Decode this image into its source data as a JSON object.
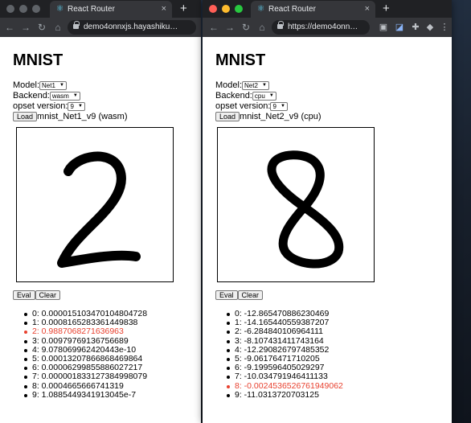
{
  "accent_highlight": "#e8412f",
  "windows": [
    {
      "tab": {
        "title": "React Router",
        "icon": "react-icon",
        "close": "×"
      },
      "new_tab": "+",
      "address": "demo4onnxjs.hayashiku…",
      "app": {
        "title": "MNIST",
        "model_label": "Model:",
        "model_value": "Net1",
        "backend_label": "Backend:",
        "backend_value": "wasm",
        "opset_label": "opset version:",
        "opset_value": "9",
        "load_label": "Load",
        "status": "mnist_Net1_v9 (wasm)",
        "drawn_digit": "2",
        "eval_label": "Eval",
        "clear_label": "Clear",
        "predictions": [
          "0: 0.0000151034701048047​28",
          "1: 0.0008165283361449838",
          "2: 0.9887068271636963",
          "3: 0.00979769136756689",
          "4: 9.078069962420443e-10",
          "5: 0.0001320786686846986​4",
          "6: 0.0000629985588602721​7",
          "7: 0.0000018331273849980​79",
          "8: 0.0004665666741319",
          "9: 1.0885449341913045e-7"
        ],
        "top_index": 2
      }
    },
    {
      "tab": {
        "title": "React Router",
        "icon": "react-icon",
        "close": "×"
      },
      "new_tab": "+",
      "address": "https://demo4onn…",
      "app": {
        "title": "MNIST",
        "model_label": "Model:",
        "model_value": "Net2",
        "backend_label": "Backend:",
        "backend_value": "cpu",
        "opset_label": "opset version:",
        "opset_value": "9",
        "load_label": "Load",
        "status": "mnist_Net2_v9 (cpu)",
        "drawn_digit": "8",
        "eval_label": "Eval",
        "clear_label": "Clear",
        "predictions": [
          "0: -12.865470886230469",
          "1: -14.165440559387207",
          "2: -6.284840106964111",
          "3: -8.107431411743164",
          "4: -12.290826797485352",
          "5: -9.06176471710205",
          "6: -9.199596405029297",
          "7: -10.034791946411133",
          "8: -0.0024536526761949062",
          "9: -11.0313720703125"
        ],
        "top_index": 8
      }
    }
  ]
}
